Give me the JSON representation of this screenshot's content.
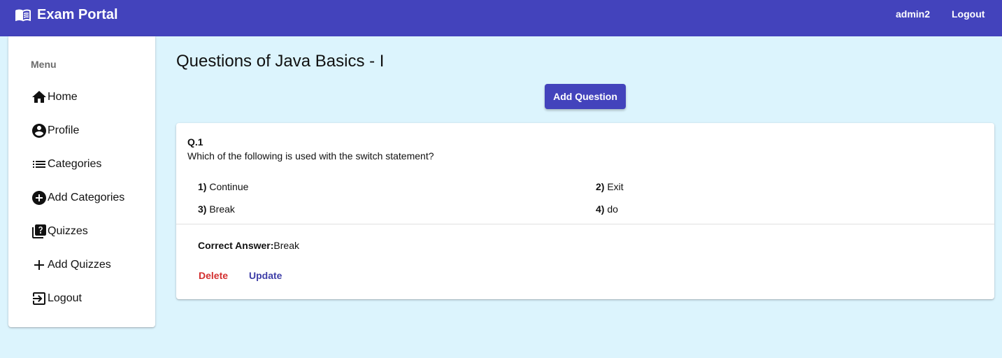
{
  "header": {
    "brand": "Exam Portal",
    "brand_icon": "open-book-icon",
    "user": "admin2",
    "logout": "Logout"
  },
  "sidebar": {
    "title": "Menu",
    "items": [
      {
        "label": "Home",
        "icon": "home-icon"
      },
      {
        "label": "Profile",
        "icon": "account-circle-icon"
      },
      {
        "label": "Categories",
        "icon": "list-icon"
      },
      {
        "label": "Add Categories",
        "icon": "add-circle-icon"
      },
      {
        "label": "Quizzes",
        "icon": "quiz-icon"
      },
      {
        "label": "Add Quizzes",
        "icon": "plus-icon"
      },
      {
        "label": "Logout",
        "icon": "logout-icon"
      }
    ]
  },
  "main": {
    "title": "Questions of Java Basics - I",
    "add_button": "Add Question",
    "questions": [
      {
        "number": "Q.1",
        "text": "Which of the following is used with the switch statement?",
        "options": [
          {
            "num": "1)",
            "text": "Continue"
          },
          {
            "num": "2)",
            "text": "Exit"
          },
          {
            "num": "3)",
            "text": "Break"
          },
          {
            "num": "4)",
            "text": "do"
          }
        ],
        "answer_label": "Correct Answer:",
        "answer": "Break",
        "delete_label": "Delete",
        "update_label": "Update"
      }
    ]
  },
  "colors": {
    "primary": "#4343bc",
    "background": "#dcf4fd",
    "danger": "#d32f2f"
  }
}
